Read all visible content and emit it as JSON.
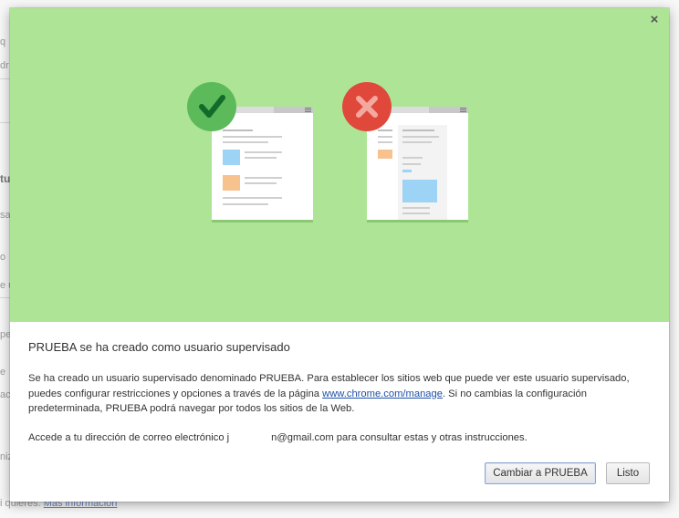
{
  "background": {
    "fragments": [
      "q",
      "dr",
      "tu",
      "sa",
      "o",
      "e u",
      "pe",
      "e",
      "ac",
      "niz",
      "i quieres."
    ],
    "bg_link": "Más información"
  },
  "dialog": {
    "close_glyph": "×",
    "title": "PRUEBA se ha creado como usuario supervisado",
    "paragraph1_part1": "Se ha creado un usuario supervisado denominado PRUEBA. Para establecer los sitios web que puede ver este usuario supervisado, puedes configurar restricciones y opciones a través de la página ",
    "manage_link": "www.chrome.com/manage",
    "paragraph1_part2": ". Si no cambias la configuración predeterminada, PRUEBA podrá navegar por todos los sitios de la Web.",
    "paragraph2_part1": "Accede a tu dirección de correo electrónico j",
    "paragraph2_part2": "n@gmail.com para consultar estas y otras instrucciones.",
    "switch_button": "Cambiar a PRUEBA",
    "done_button": "Listo"
  },
  "illustration": {
    "allowed_icon": "checkmark-icon",
    "blocked_icon": "cross-icon",
    "colors": {
      "hero_bg": "#aee495",
      "allowed_badge": "#5cba5a",
      "blocked_badge": "#e0483b",
      "blue_block": "#9dd3f5",
      "orange_block": "#f7c28e"
    }
  }
}
